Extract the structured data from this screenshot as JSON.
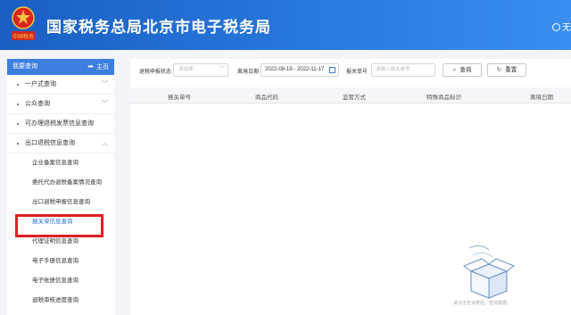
{
  "header": {
    "title": "国家税务总局北京市电子税务局",
    "right_text": "无",
    "emblem_text": "中国税务"
  },
  "sidebar": {
    "head_label": "我要查询",
    "home_label": "主页",
    "items": [
      {
        "label": "一户式查询",
        "expandable": true
      },
      {
        "label": "公众查询",
        "expandable": true
      },
      {
        "label": "可办理退税发票信息查询",
        "expandable": false
      },
      {
        "label": "出口退税信息查询",
        "expandable": true
      }
    ],
    "sub_items": [
      "企业备案信息查询",
      "委托代办退税备案情况查询",
      "出口退税申报信息查询",
      "报关单信息查询",
      "代理证明信息查询",
      "电子手册信息查询",
      "电子账册信息查询",
      "退税审核进度查询"
    ],
    "active_sub_index": 3
  },
  "filter": {
    "status_label": "退税申报状态",
    "status_placeholder": "请选择",
    "date_label": "离境日期",
    "date_value": "2022-08-19 - 2022-11-17",
    "declaration_label": "报关单号",
    "declaration_placeholder": "请输入报关单号",
    "search_label": "查询",
    "reset_label": "重置"
  },
  "table": {
    "columns": [
      "报关单号",
      "商品代码",
      "监管方式",
      "特殊商品标识",
      "离境日期"
    ]
  },
  "empty_state": {
    "text": "请点击查询按钮，查询数据。"
  },
  "colors": {
    "header_blue": "#2a7be0",
    "accent": "#3d7fde",
    "highlight_red": "#e02020"
  }
}
